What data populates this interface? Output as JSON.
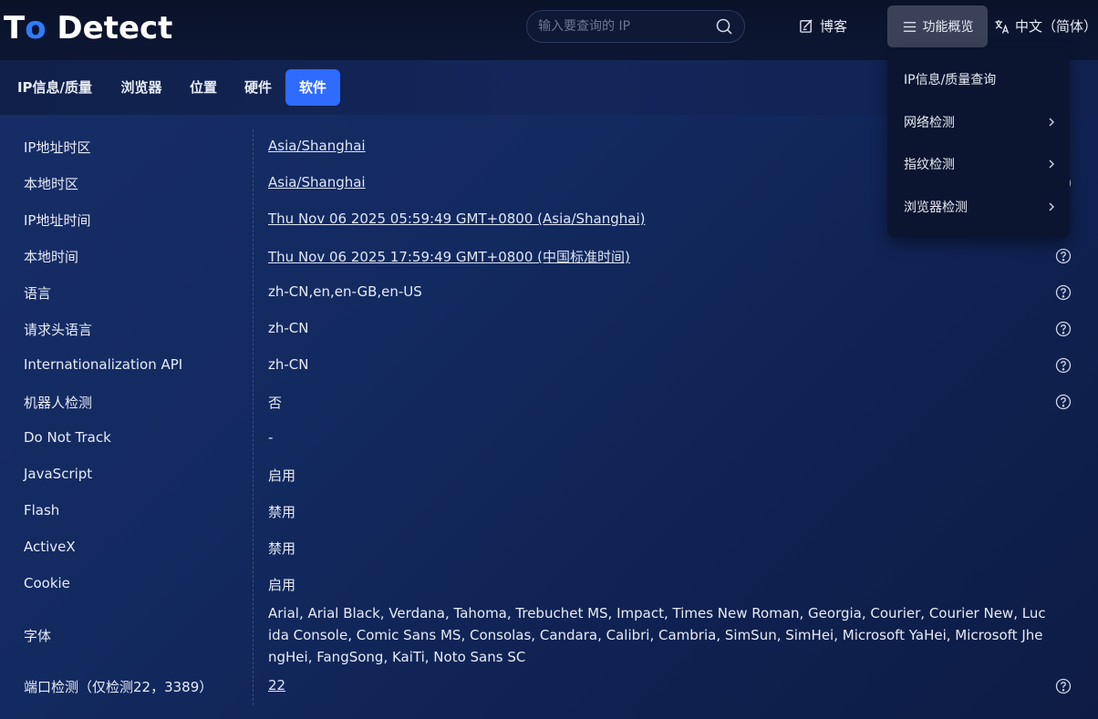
{
  "header": {
    "logo_to": "To",
    "logo_detect": "Detect",
    "search_placeholder": "输入要查询的 IP",
    "blog_label": "博客",
    "features_label": "功能概览",
    "lang_label": "中文（简体）"
  },
  "tabs": [
    {
      "label": "IP信息/质量",
      "active": false
    },
    {
      "label": "浏览器",
      "active": false
    },
    {
      "label": "位置",
      "active": false
    },
    {
      "label": "硬件",
      "active": false
    },
    {
      "label": "软件",
      "active": true
    }
  ],
  "rows": [
    {
      "label": "IP地址时区",
      "value": "Asia/Shanghai",
      "link": true,
      "help": false
    },
    {
      "label": "本地时区",
      "value": "Asia/Shanghai",
      "link": true,
      "help": true
    },
    {
      "label": "IP地址时间",
      "value": "Thu Nov 06 2025 05:59:49 GMT+0800 (Asia/Shanghai)",
      "link": true,
      "help": false
    },
    {
      "label": "本地时间",
      "value": "Thu Nov 06 2025 17:59:49 GMT+0800 (中国标准时间)",
      "link": true,
      "help": true
    },
    {
      "label": "语言",
      "value": "zh-CN,en,en-GB,en-US",
      "link": false,
      "help": true
    },
    {
      "label": "请求头语言",
      "value": "zh-CN",
      "link": false,
      "help": true
    },
    {
      "label": "Internationalization API",
      "value": "zh-CN",
      "link": false,
      "help": true
    },
    {
      "label": "机器人检测",
      "value": "否",
      "link": false,
      "help": true
    },
    {
      "label": "Do Not Track",
      "value": "-",
      "link": false,
      "help": false
    },
    {
      "label": "JavaScript",
      "value": "启用",
      "link": false,
      "help": false
    },
    {
      "label": "Flash",
      "value": "禁用",
      "link": false,
      "help": false
    },
    {
      "label": "ActiveX",
      "value": "禁用",
      "link": false,
      "help": false
    },
    {
      "label": "Cookie",
      "value": "启用",
      "link": false,
      "help": false
    },
    {
      "label": "字体",
      "value": "Arial, Arial Black, Verdana, Tahoma, Trebuchet MS, Impact, Times New Roman, Georgia, Courier, Courier New, Lucida Console, Comic Sans MS, Consolas, Candara, Calibri, Cambria, SimSun, SimHei, Microsoft YaHei, Microsoft JhengHei, FangSong, KaiTi, Noto Sans SC",
      "link": false,
      "help": false
    },
    {
      "label": "端口检测（仅检测22，3389）",
      "value": "22",
      "link": true,
      "help": true
    }
  ],
  "dropdown": [
    {
      "label": "IP信息/质量查询",
      "submenu": false
    },
    {
      "label": "网络检测",
      "submenu": true
    },
    {
      "label": "指纹检测",
      "submenu": true
    },
    {
      "label": "浏览器检测",
      "submenu": true
    }
  ],
  "colors": {
    "accent": "#2f6bff",
    "logo_o": "#2f7bff"
  }
}
